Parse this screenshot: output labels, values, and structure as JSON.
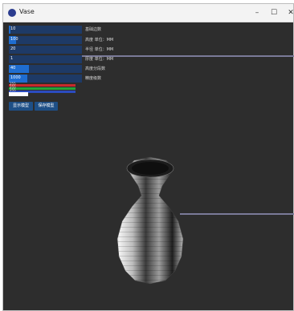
{
  "window": {
    "title": "Vase"
  },
  "sliders": [
    {
      "value": "10",
      "fill": 0.02,
      "label": "基础边数"
    },
    {
      "value": "100",
      "fill": 0.1,
      "label": "高度 单位：MM"
    },
    {
      "value": "20",
      "fill": 0.0,
      "label": "半径 单位：MM"
    },
    {
      "value": "1",
      "fill": 0.0,
      "label": "厚度 单位：MM"
    },
    {
      "value": "40",
      "fill": 0.28,
      "label": "高度分段数"
    },
    {
      "value": "1000",
      "fill": 0.25,
      "label": "精度级数"
    }
  ],
  "color": {
    "channels": [
      {
        "name": "R",
        "label": "255"
      },
      {
        "name": "G",
        "label": "255"
      },
      {
        "name": "B",
        "label": "255"
      }
    ],
    "strip_colors": [
      "#c8292b",
      "#24a43a",
      "#2b4cc0"
    ]
  },
  "buttons": {
    "show_model": "显示模型",
    "save_model": "保存模型"
  }
}
